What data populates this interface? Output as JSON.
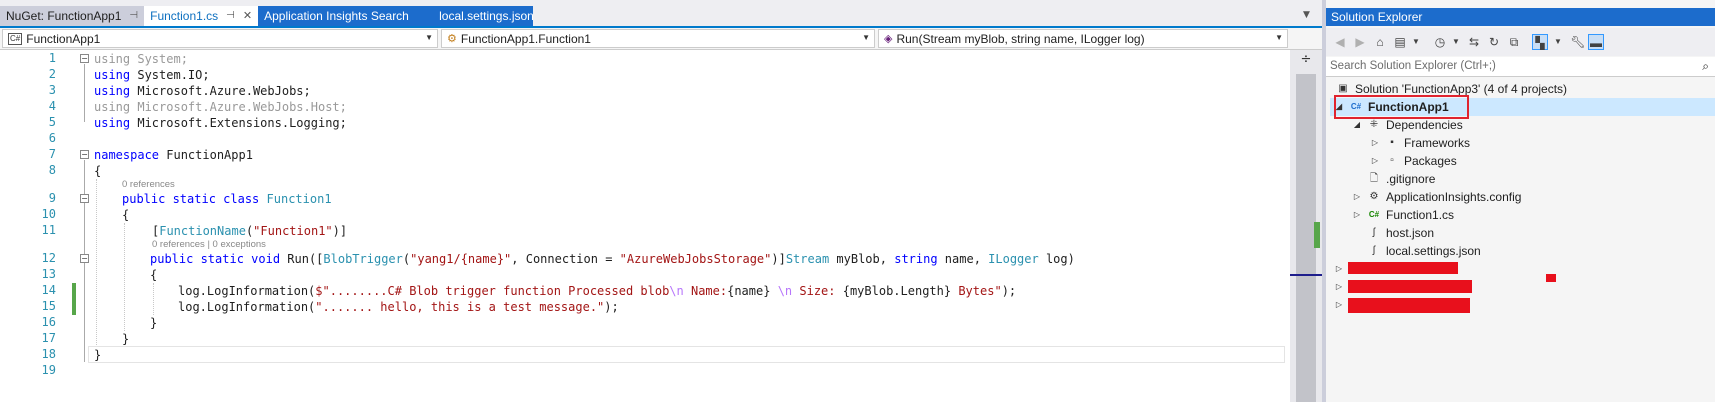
{
  "tabs": [
    {
      "label": "NuGet: FunctionApp1",
      "pinned": true,
      "closable": false,
      "state": "inactive"
    },
    {
      "label": "Function1.cs",
      "pinned": true,
      "closable": true,
      "state": "active"
    },
    {
      "label": "Application Insights Search",
      "pinned": false,
      "closable": false,
      "state": "blue"
    },
    {
      "label": "local.settings.json",
      "pinned": false,
      "closable": false,
      "state": "blue"
    }
  ],
  "navbar": {
    "project": "FunctionApp1",
    "type": "FunctionApp1.Function1",
    "member": "Run(Stream myBlob, string name, ILogger log)"
  },
  "editor": {
    "line_numbers": [
      "1",
      "2",
      "3",
      "4",
      "5",
      "6",
      "7",
      "8",
      "9",
      "10",
      "11",
      "12",
      "13",
      "14",
      "15",
      "16",
      "17",
      "18",
      "19"
    ],
    "lens_class": "0 references",
    "lens_method": "0 references | 0 exceptions",
    "code": {
      "l1_using": "using",
      "l1_rest": " System;",
      "l2_using": "using",
      "l2_rest": " System.IO;",
      "l3_using": "using",
      "l3_rest": " Microsoft.Azure.WebJobs;",
      "l4_full": "using Microsoft.Azure.WebJobs.Host;",
      "l5_using": "using",
      "l5_rest": " Microsoft.Extensions.Logging;",
      "l7_ns": "namespace",
      "l7_name": " FunctionApp1",
      "l8": "{",
      "l9_mods": "public static class",
      "l9_name": "Function1",
      "l10": "{",
      "l11_open": "[",
      "l11_attr": "FunctionName",
      "l11_p1": "(",
      "l11_str": "\"Function1\"",
      "l11_close": ")]",
      "l12_mods": "public static void",
      "l12_run": " Run([",
      "l12_attr": "BlobTrigger",
      "l12_p1": "(",
      "l12_str1": "\"yang1/{name}\"",
      "l12_mid": ", Connection = ",
      "l12_str2": "\"AzureWebJobsStorage\"",
      "l12_p2": ")]",
      "l12_stream": "Stream",
      "l12_myblob": " myBlob, ",
      "l12_string": "string",
      "l12_name": " name, ",
      "l12_ilogger": "ILogger",
      "l12_log": " log)",
      "l13": "{",
      "l14_call": "log.LogInformation(",
      "l14_s1": "$\"........C# Blob trigger function Processed blob",
      "l14_esc1": "\\n",
      "l14_s2": " Name:",
      "l14_i1": "{name}",
      "l14_s3": " ",
      "l14_esc2": "\\n",
      "l14_s4": " Size: ",
      "l14_i2": "{myBlob.Length}",
      "l14_s5": " Bytes\"",
      "l14_end": ");",
      "l15_call": "log.LogInformation(",
      "l15_str": "\"....... hello, this is a test message.\"",
      "l15_end": ");",
      "l16": "}",
      "l17": "}",
      "l18": "}"
    }
  },
  "solution_explorer": {
    "title": "Solution Explorer",
    "search_placeholder": "Search Solution Explorer (Ctrl+;)",
    "solution": "Solution 'FunctionApp3' (4 of 4 projects)",
    "project": "FunctionApp1",
    "items": {
      "dependencies": "Dependencies",
      "frameworks": "Frameworks",
      "packages": "Packages",
      "gitignore": ".gitignore",
      "appinsights": "ApplicationInsights.config",
      "function1": "Function1.cs",
      "host": "host.json",
      "localsettings": "local.settings.json"
    },
    "cs_badge": "C#"
  },
  "colors": {
    "accent": "#007acc",
    "selected_tab_bg": "#1c6ccc",
    "highlight_red": "#e0242f",
    "redaction_red": "#e8101c",
    "change_green": "#57a64a"
  }
}
